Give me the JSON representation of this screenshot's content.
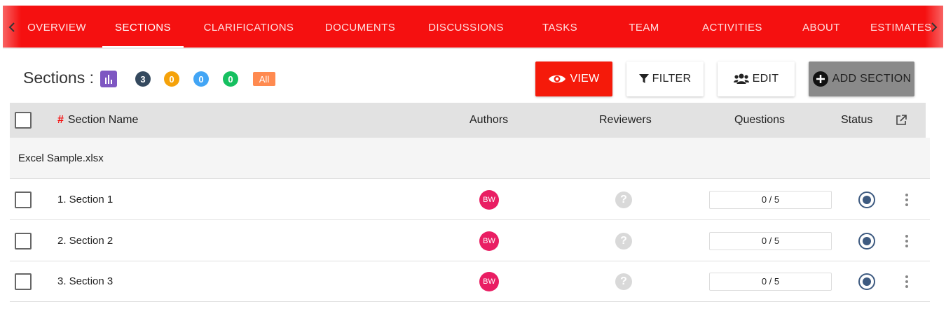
{
  "nav": {
    "tabs": [
      {
        "label": "OVERVIEW"
      },
      {
        "label": "SECTIONS"
      },
      {
        "label": "CLARIFICATIONS"
      },
      {
        "label": "DOCUMENTS"
      },
      {
        "label": "DISCUSSIONS"
      },
      {
        "label": "TASKS"
      },
      {
        "label": "TEAM"
      },
      {
        "label": "ACTIVITIES"
      },
      {
        "label": "ABOUT"
      },
      {
        "label": "ESTIMATES"
      }
    ],
    "active_tab": "SECTIONS"
  },
  "toolbar": {
    "title": "Sections :",
    "counts": [
      {
        "value": "3",
        "color": "#34495e"
      },
      {
        "value": "0",
        "color": "#f5a20a"
      },
      {
        "value": "0",
        "color": "#42a5f5"
      },
      {
        "value": "0",
        "color": "#16c060"
      }
    ],
    "all_label": "All",
    "all_color": "#ff8a50",
    "view_label": "VIEW",
    "filter_label": "FILTER",
    "edit_label": "EDIT",
    "add_label": "ADD SECTION"
  },
  "table": {
    "headers": {
      "hash": "#",
      "name": "Section Name",
      "authors": "Authors",
      "reviewers": "Reviewers",
      "questions": "Questions",
      "status": "Status"
    },
    "group": "Excel Sample.xlsx",
    "rows": [
      {
        "name": "1. Section 1",
        "author": "BW",
        "questions": "0 / 5"
      },
      {
        "name": "2. Section 2",
        "author": "BW",
        "questions": "0 / 5"
      },
      {
        "name": "3. Section 3",
        "author": "BW",
        "questions": "0 / 5"
      }
    ]
  }
}
